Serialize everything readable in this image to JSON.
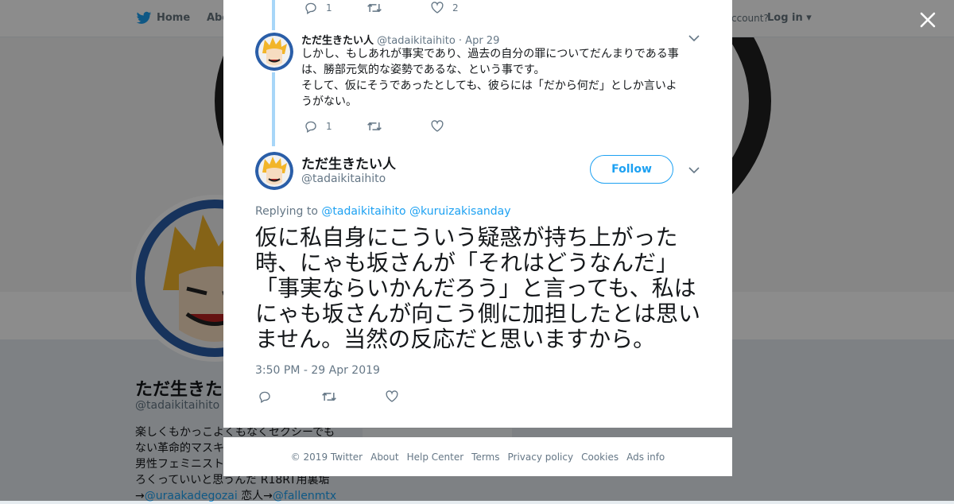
{
  "nav": {
    "home": "Home",
    "about": "Abo",
    "account_prompt": "ccount?",
    "login": "Log in"
  },
  "profile": {
    "name": "ただ生きた",
    "handle": "@tadaikitaihito",
    "bio_lines": [
      "楽しくもかっこよくもなくセクシーでも",
      "ない革命的マスキ",
      "男性フェミニスト",
      "ろくっていいと思うんだ R18RT用裏垢"
    ],
    "bio_link1": "@uraakadegozai",
    "bio_mid": "恋人→",
    "bio_link2": "@fallenmtx",
    "bio_arrow": "→"
  },
  "top_actions": {
    "reply_count": "1",
    "like_count": "2"
  },
  "prev_tweet": {
    "name": "ただ生きたい人",
    "handle": "@tadaikitaihito",
    "date": "· Apr 29",
    "text1": "しかし、もしあれが事実であり、過去の自分の罪についてだんまりである事は、勝部元気的な姿勢であるな、という事です。",
    "text2": "そして、仮にそうであったとしても、彼らには「だから何だ」としか言いようがない。",
    "reply_count": "1"
  },
  "main_tweet": {
    "name": "ただ生きたい人",
    "handle": "@tadaikitaihito",
    "follow_label": "Follow",
    "replying_label": "Replying to",
    "reply_to1": "@tadaikitaihito",
    "reply_to2": "@kuruizakisanday",
    "text": "仮に私自身にこういう疑惑が持ち上がった時、にゃも坂さんが「それはどうなんだ」「事実ならいかんだろう」と言っても、私はにゃも坂さんが向こう側に加担したとは思いません。当然の反応だと思いますから。",
    "timestamp": "3:50 PM - 29 Apr 2019"
  },
  "footer": {
    "copyright": "© 2019 Twitter",
    "about": "About",
    "help": "Help Center",
    "terms": "Terms",
    "privacy": "Privacy policy",
    "cookies": "Cookies",
    "ads": "Ads info"
  },
  "card_partial": "Ads info",
  "colors": {
    "accent": "#1da1f2",
    "thread_line": "#a7d6f8",
    "muted": "#657786"
  },
  "icons": [
    "twitter-bird-icon",
    "reply-icon",
    "retweet-icon",
    "heart-icon",
    "chevron-down-icon",
    "close-icon"
  ]
}
